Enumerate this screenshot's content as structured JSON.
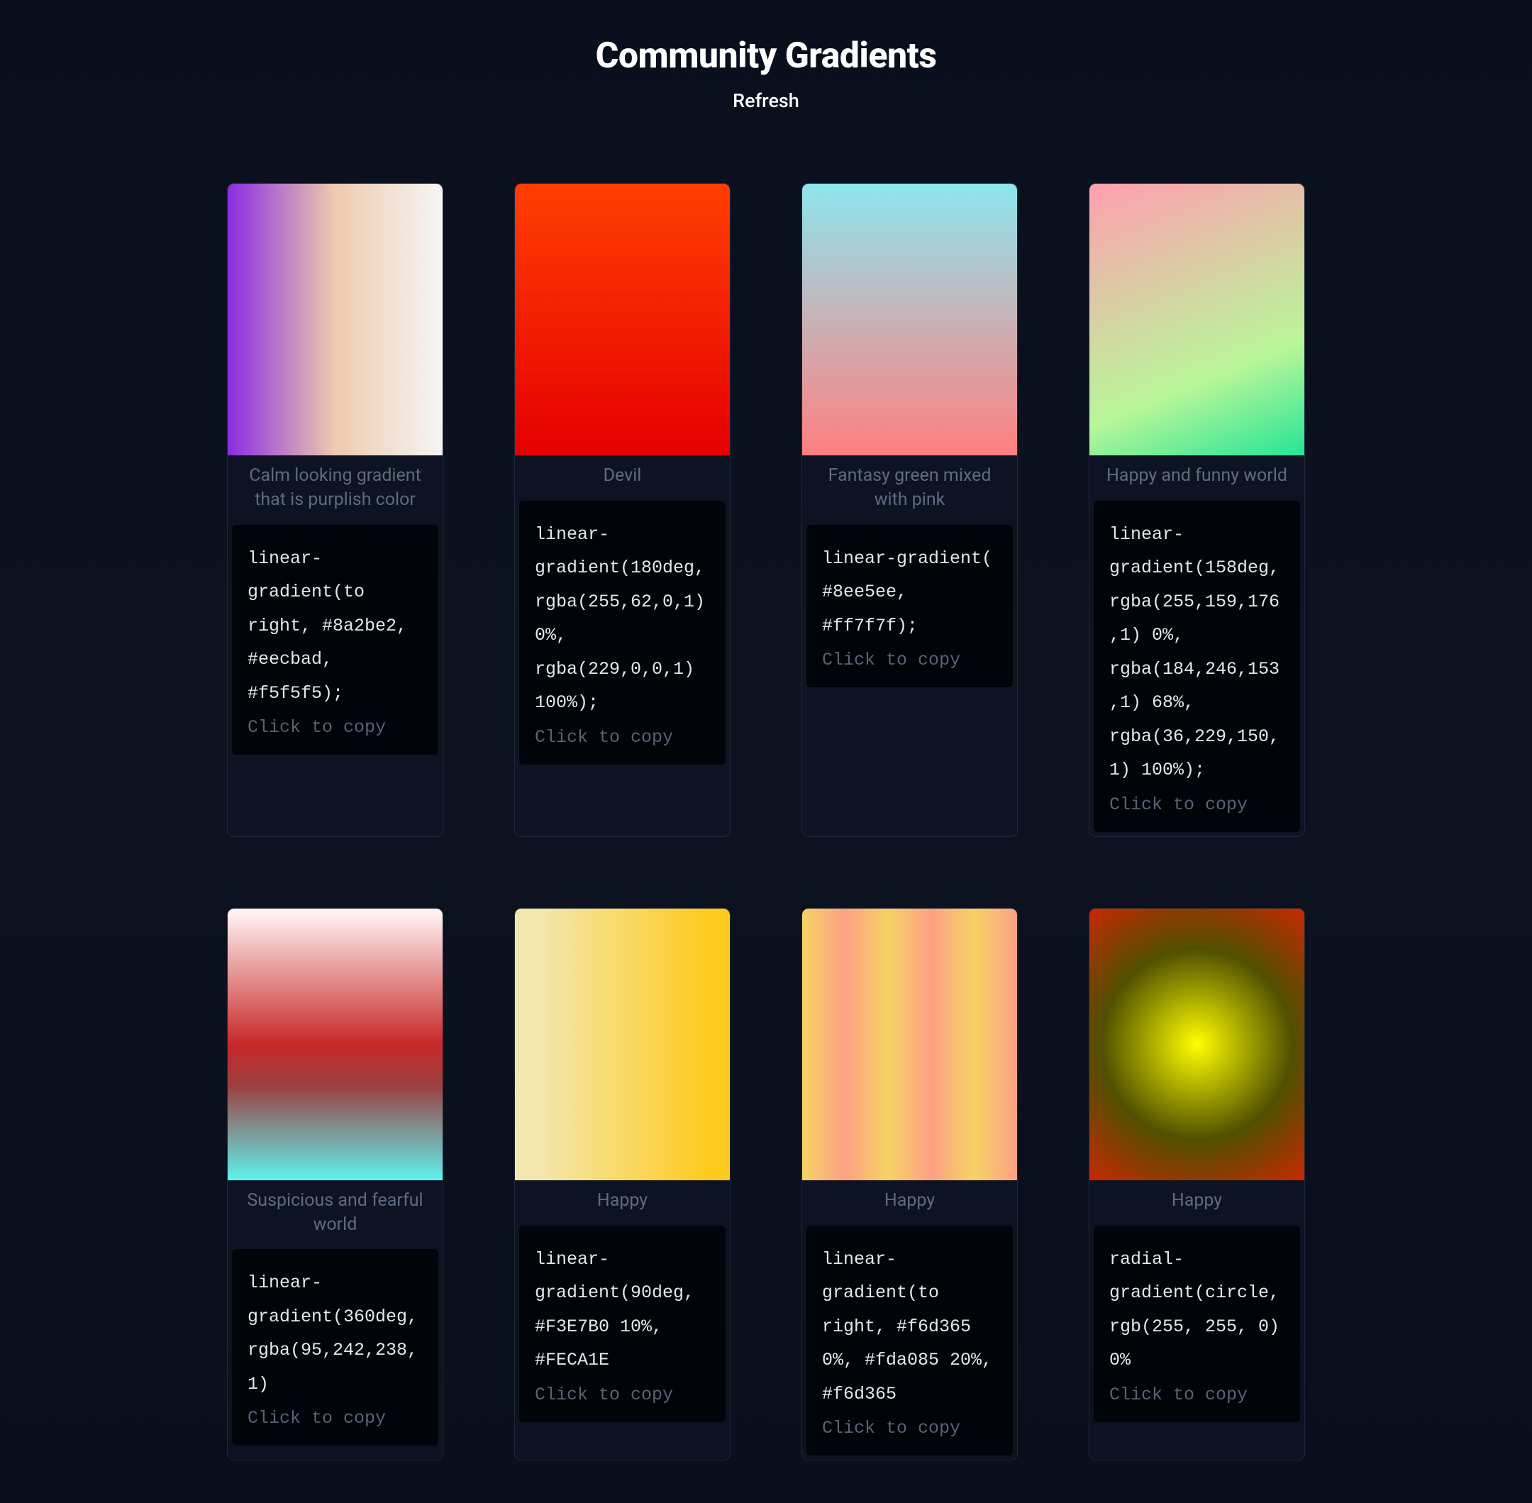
{
  "header": {
    "title": "Community Gradients",
    "refresh": "Refresh"
  },
  "copy_hint": "Click to copy",
  "cards": [
    {
      "name": "Calm looking gradient that is purplish color",
      "css": "linear-gradient(to right, #8a2be2, #eecbad, #f5f5f5);"
    },
    {
      "name": "Devil",
      "css": "linear-gradient(180deg, rgba(255,62,0,1) 0%, rgba(229,0,0,1) 100%);"
    },
    {
      "name": "Fantasy green mixed with pink",
      "css": "linear-gradient( #8ee5ee, #ff7f7f);"
    },
    {
      "name": "Happy and funny world",
      "css": "linear-gradient(158deg, rgba(255,159,176,1) 0%, rgba(184,246,153,1) 68%, rgba(36,229,150,1) 100%);"
    },
    {
      "name": "Suspicious and fearful world",
      "css": "linear-gradient(360deg, rgba(95,242,238,1)"
    },
    {
      "name": "Happy",
      "css": "linear-gradient(90deg, #F3E7B0 10%, #FECA1E"
    },
    {
      "name": "Happy",
      "css": "linear-gradient(to right, #f6d365 0%, #fda085 20%, #f6d365"
    },
    {
      "name": "Happy",
      "css": "radial-gradient(circle, rgb(255, 255, 0) 0%"
    }
  ]
}
